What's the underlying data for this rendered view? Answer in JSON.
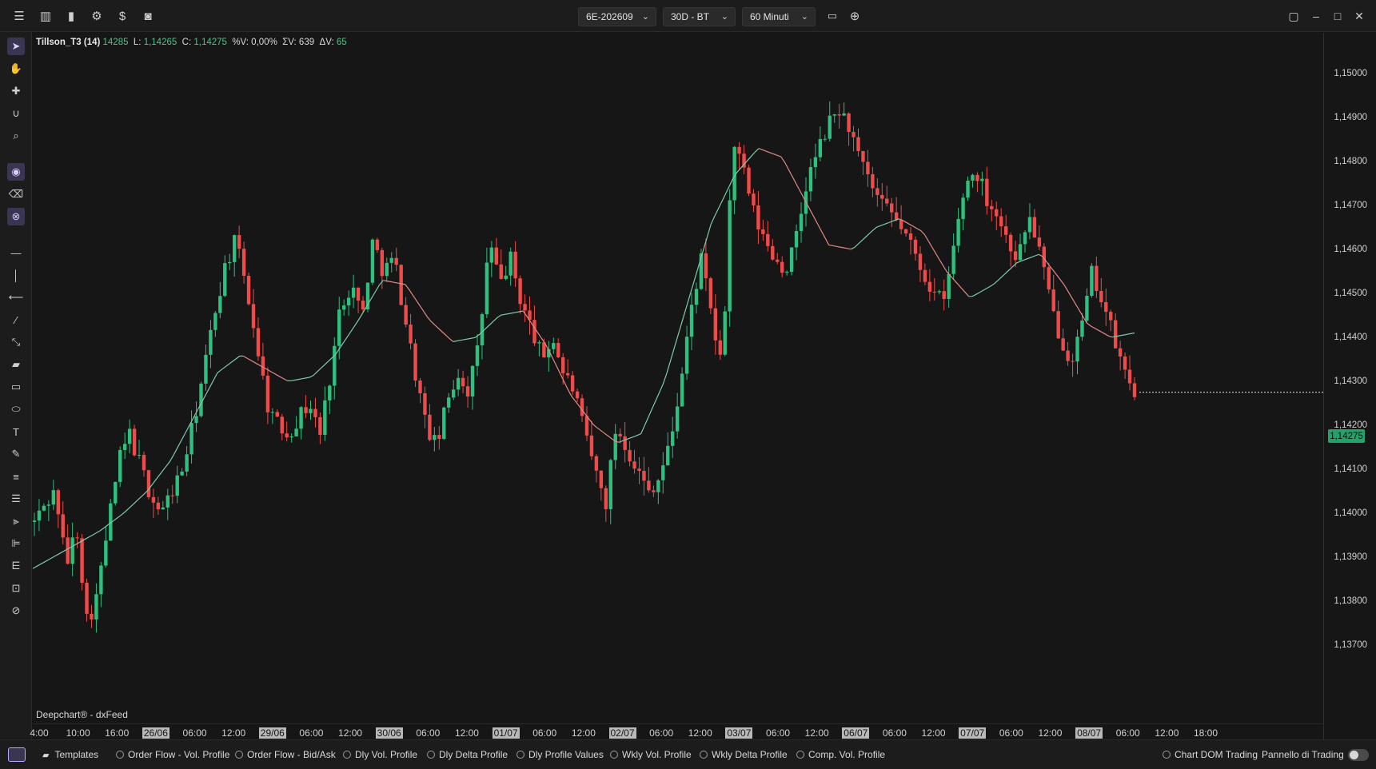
{
  "toolbar": {
    "icons": [
      "menu-icon",
      "candles-icon",
      "bar-chart-icon",
      "settings-icon",
      "dollar-icon",
      "camera-icon"
    ],
    "symbol": "6E-202609",
    "period": "30D - BT",
    "timeframe": "60 Minuti",
    "window_icons": [
      "restore-icon",
      "minimize-icon",
      "maximize-icon",
      "close-icon"
    ]
  },
  "indicator": {
    "name": "Tillson_T3 (14)",
    "value": "14285",
    "low_label": "L:",
    "low": "1,14265",
    "close_label": "C:",
    "close": "1,14275",
    "pct_label": "%V: 0,00%",
    "sum_v": "ΣV: 639",
    "delta_label": "ΔV:",
    "delta": "65"
  },
  "brand": "Deepchart® - dxFeed",
  "current_price": "1,14275",
  "colors": {
    "up": "#2fbf7f",
    "down": "#f04b4b",
    "t3": "#7fc9a8",
    "t3_down": "#e08989",
    "bg": "#161616"
  },
  "chart_data": {
    "type": "candlestick",
    "instrument": "6E-202609",
    "interval": "60 Minuti",
    "y_ticks": [
      "1,15000",
      "1,14900",
      "1,14800",
      "1,14700",
      "1,14600",
      "1,14500",
      "1,14400",
      "1,14300",
      "1,14200",
      "1,14100",
      "1,14000",
      "1,13900",
      "1,13800",
      "1,13700"
    ],
    "ylim": [
      1.137,
      1.1513
    ],
    "x_ticks": [
      {
        "label": "4:00",
        "hl": false
      },
      {
        "label": "10:00",
        "hl": false
      },
      {
        "label": "16:00",
        "hl": false
      },
      {
        "label": "26/06",
        "hl": true
      },
      {
        "label": "06:00",
        "hl": false
      },
      {
        "label": "12:00",
        "hl": false
      },
      {
        "label": "29/06",
        "hl": true
      },
      {
        "label": "06:00",
        "hl": false
      },
      {
        "label": "12:00",
        "hl": false
      },
      {
        "label": "30/06",
        "hl": true
      },
      {
        "label": "06:00",
        "hl": false
      },
      {
        "label": "12:00",
        "hl": false
      },
      {
        "label": "01/07",
        "hl": true
      },
      {
        "label": "06:00",
        "hl": false
      },
      {
        "label": "12:00",
        "hl": false
      },
      {
        "label": "02/07",
        "hl": true
      },
      {
        "label": "06:00",
        "hl": false
      },
      {
        "label": "12:00",
        "hl": false
      },
      {
        "label": "03/07",
        "hl": true
      },
      {
        "label": "06:00",
        "hl": false
      },
      {
        "label": "12:00",
        "hl": false
      },
      {
        "label": "06/07",
        "hl": true
      },
      {
        "label": "06:00",
        "hl": false
      },
      {
        "label": "12:00",
        "hl": false
      },
      {
        "label": "07/07",
        "hl": true
      },
      {
        "label": "06:00",
        "hl": false
      },
      {
        "label": "12:00",
        "hl": false
      },
      {
        "label": "08/07",
        "hl": true
      },
      {
        "label": "06:00",
        "hl": false
      },
      {
        "label": "12:00",
        "hl": false
      },
      {
        "label": "18:00",
        "hl": false
      }
    ],
    "close_path": [
      1.1398,
      1.1402,
      1.1405,
      1.1388,
      1.1397,
      1.1375,
      1.1382,
      1.1398,
      1.1412,
      1.1418,
      1.1411,
      1.1404,
      1.14,
      1.1405,
      1.141,
      1.142,
      1.1432,
      1.1445,
      1.1456,
      1.1462,
      1.1452,
      1.1439,
      1.1425,
      1.142,
      1.1418,
      1.1422,
      1.1425,
      1.1418,
      1.1432,
      1.1448,
      1.1452,
      1.1445,
      1.1462,
      1.1455,
      1.1458,
      1.1445,
      1.1432,
      1.142,
      1.1415,
      1.1425,
      1.1432,
      1.1428,
      1.1438,
      1.1462,
      1.1452,
      1.1458,
      1.1448,
      1.1442,
      1.1435,
      1.144,
      1.1432,
      1.1428,
      1.1418,
      1.141,
      1.1402,
      1.142,
      1.1415,
      1.141,
      1.1405,
      1.1408,
      1.1415,
      1.1428,
      1.1445,
      1.1458,
      1.1445,
      1.1432,
      1.1485,
      1.1478,
      1.1468,
      1.1462,
      1.1458,
      1.1455,
      1.1462,
      1.1475,
      1.1482,
      1.1488,
      1.1492,
      1.1488,
      1.148,
      1.1475,
      1.147,
      1.1468,
      1.1465,
      1.146,
      1.1455,
      1.145,
      1.1448,
      1.1462,
      1.1475,
      1.1478,
      1.1472,
      1.1468,
      1.1462,
      1.1458,
      1.1468,
      1.146,
      1.1448,
      1.144,
      1.1435,
      1.1442,
      1.1455,
      1.1448,
      1.144,
      1.1432,
      1.1428
    ],
    "t3_path": [
      1.1387,
      1.139,
      1.1393,
      1.1396,
      1.14,
      1.1405,
      1.1412,
      1.1422,
      1.1432,
      1.1436,
      1.1433,
      1.143,
      1.1431,
      1.1436,
      1.1444,
      1.1453,
      1.1452,
      1.1444,
      1.1439,
      1.144,
      1.1445,
      1.1446,
      1.1438,
      1.1427,
      1.142,
      1.1416,
      1.1418,
      1.143,
      1.1448,
      1.1466,
      1.1477,
      1.1483,
      1.1481,
      1.1471,
      1.1461,
      1.146,
      1.1465,
      1.1467,
      1.1464,
      1.1455,
      1.1449,
      1.1452,
      1.1457,
      1.1459,
      1.1452,
      1.1443,
      1.144,
      1.1441
    ],
    "t3_turns_down_at": [
      0.06,
      0.24,
      0.37,
      0.53,
      0.61,
      0.8,
      0.92
    ]
  },
  "bottom": {
    "templates": "Templates",
    "items": [
      "Order Flow - Vol. Profile",
      "Order Flow - Bid/Ask",
      "Dly Vol. Profile",
      "Dly Delta Profile",
      "Dly Profile Values",
      "Wkly Vol. Profile",
      "Wkly Delta Profile",
      "Comp. Vol. Profile"
    ],
    "dom": "Chart DOM Trading",
    "panel": "Pannello di Trading"
  }
}
